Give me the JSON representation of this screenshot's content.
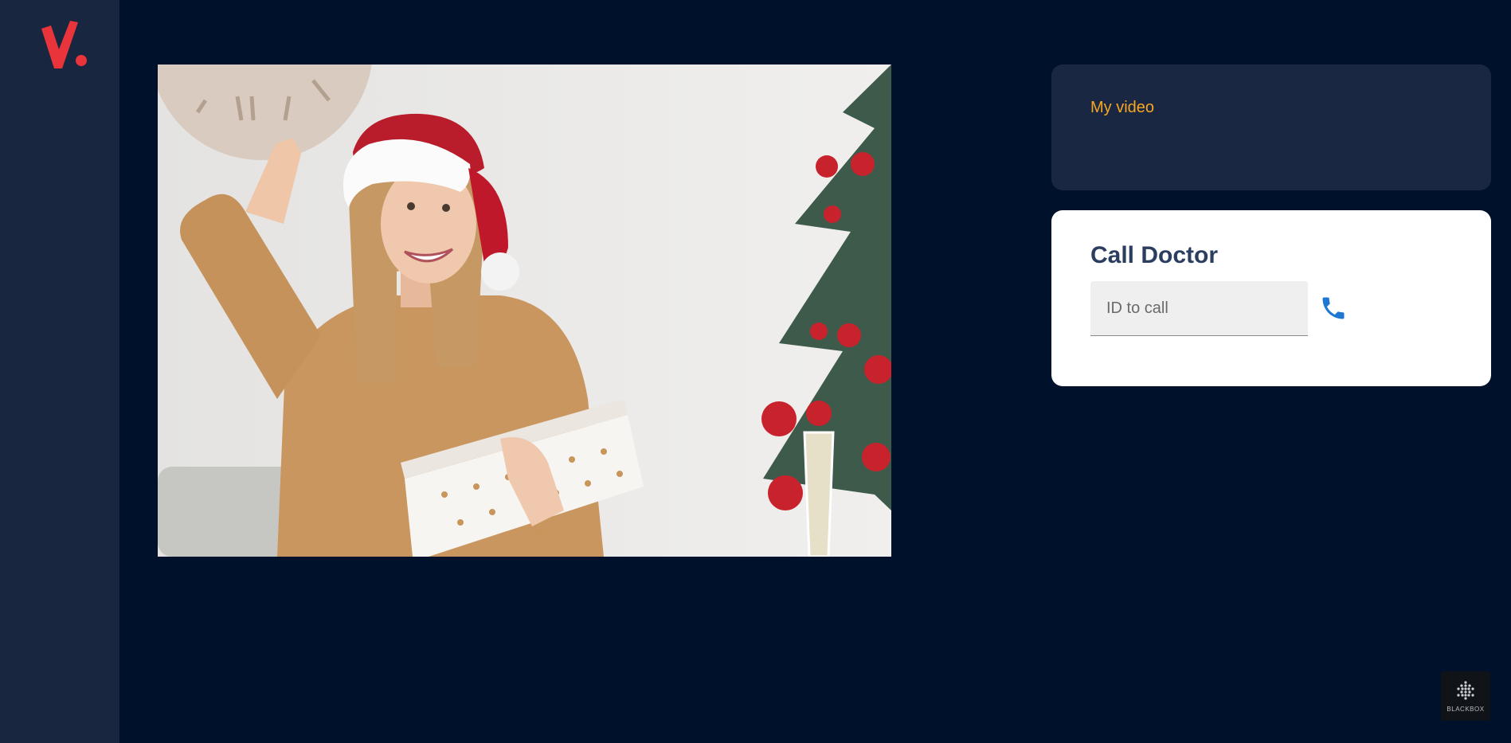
{
  "my_video": {
    "label": "My video"
  },
  "call_doctor": {
    "title": "Call Doctor",
    "input_placeholder": "ID to call",
    "input_value": "",
    "call_icon": "phone-icon"
  },
  "footer": {
    "brand_label": "BLACKBOX"
  },
  "colors": {
    "background": "#00112b",
    "sidebar": "#18263f",
    "accent_orange": "#f5a623",
    "logo_red": "#e8343a",
    "phone_blue": "#1e78d2",
    "title_navy": "#2c3e5f"
  }
}
